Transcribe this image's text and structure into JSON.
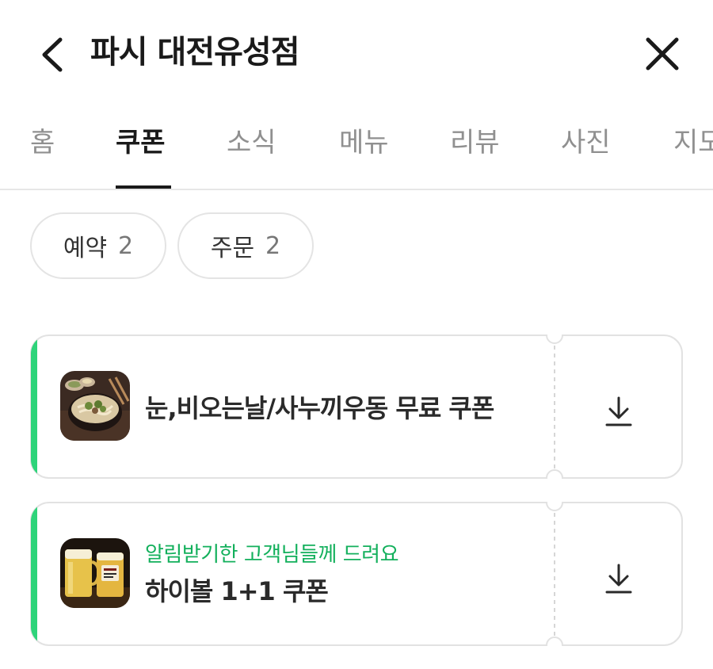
{
  "header": {
    "title": "파시 대전유성점",
    "back_icon": "chevron-left-icon",
    "close_icon": "close-icon"
  },
  "tabs": [
    {
      "label": "홈",
      "active": false
    },
    {
      "label": "쿠폰",
      "active": true
    },
    {
      "label": "소식",
      "active": false
    },
    {
      "label": "메뉴",
      "active": false
    },
    {
      "label": "리뷰",
      "active": false
    },
    {
      "label": "사진",
      "active": false
    },
    {
      "label": "지도",
      "active": false
    }
  ],
  "filters": [
    {
      "label": "예약",
      "count": "2"
    },
    {
      "label": "주문",
      "count": "2"
    }
  ],
  "coupons": [
    {
      "subtitle": "",
      "title": "눈,비오는날/사누끼우동 무료 쿠폰",
      "thumbnail": "udon-bowl",
      "action_icon": "download-icon"
    },
    {
      "subtitle": "알림받기한 고객님들께 드려요",
      "title": "하이볼 1+1 쿠폰",
      "thumbnail": "highball-mugs",
      "action_icon": "download-icon"
    }
  ],
  "colors": {
    "accent_green": "#13b05c",
    "coupon_stripe": "#2ed47a",
    "text_primary": "#1a1a1a",
    "text_muted": "#909090"
  }
}
